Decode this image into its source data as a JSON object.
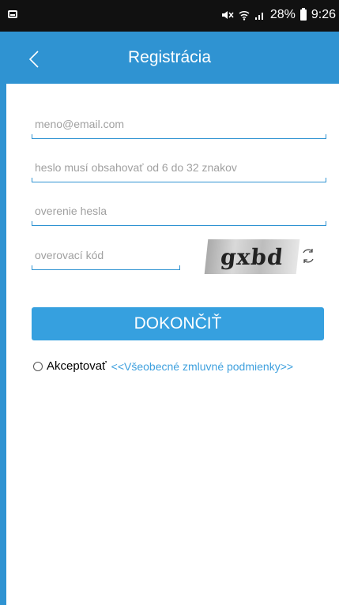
{
  "status_bar": {
    "battery_percent": "28%",
    "time": "9:26"
  },
  "header": {
    "title": "Registrácia"
  },
  "form": {
    "email_placeholder": "meno@email.com",
    "password_placeholder": "heslo musí obsahovať od 6 do 32 znakov",
    "confirm_password_placeholder": "overenie hesla",
    "verification_code_placeholder": "overovací kód",
    "captcha_text": "gxbd",
    "submit_label": "DOKONČIŤ"
  },
  "terms": {
    "accept_label": "Akceptovať",
    "link_text": "<<Všeobecné zmluvné podmienky>>"
  },
  "colors": {
    "primary": "#2f93d2",
    "button": "#36a0df",
    "link": "#3ea0de",
    "status_bar": "#111111"
  },
  "icons": [
    "back-arrow-icon",
    "refresh-icon",
    "wifi-icon",
    "signal-icon",
    "mute-icon",
    "battery-icon"
  ]
}
